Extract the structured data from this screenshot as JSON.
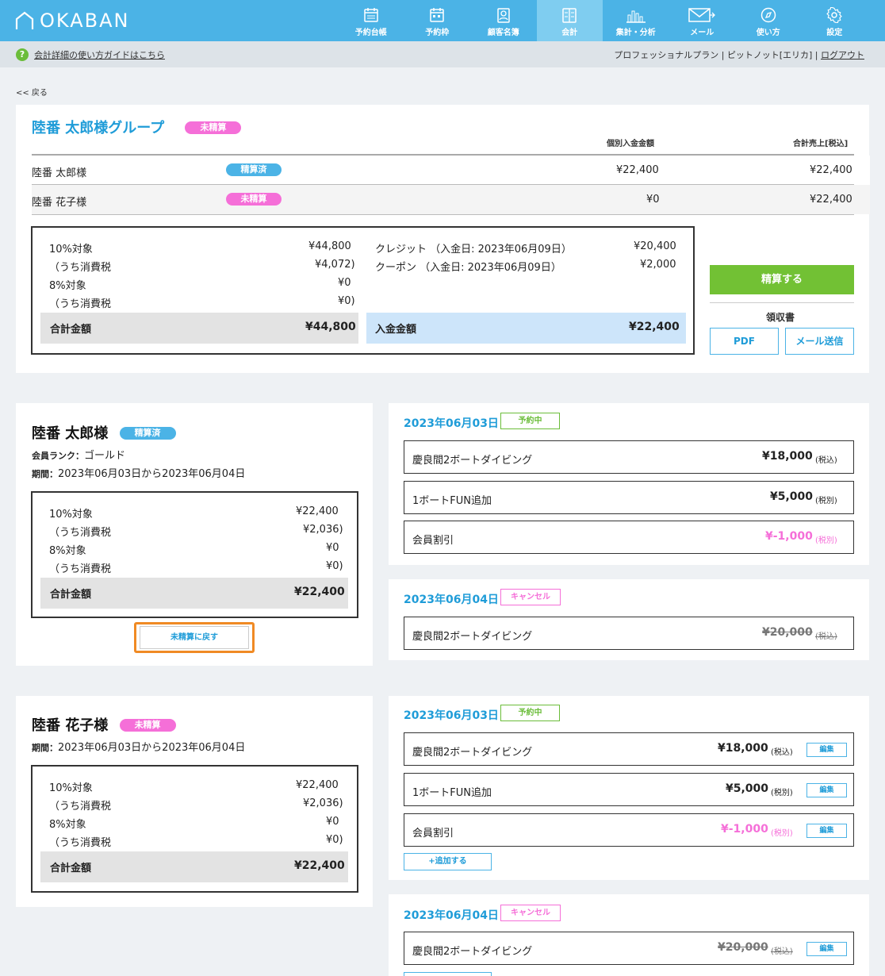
{
  "app": {
    "logo": "OKABAN"
  },
  "nav": [
    {
      "label": "予約台帳",
      "icon": "calendar-list-icon"
    },
    {
      "label": "予約枠",
      "icon": "calendar-slot-icon"
    },
    {
      "label": "顧客名簿",
      "icon": "contacts-book-icon"
    },
    {
      "label": "会計",
      "icon": "ledger-icon"
    },
    {
      "label": "集計・分析",
      "icon": "bar-chart-icon"
    },
    {
      "label": "メール",
      "icon": "mail-icon"
    },
    {
      "label": "使い方",
      "icon": "compass-icon"
    },
    {
      "label": "設定",
      "icon": "gear-icon"
    }
  ],
  "subbar": {
    "help_text": "会計詳細の使い方ガイドはこちら",
    "account": "プロフェッショナルプラン | ピットノット[エリカ] |",
    "logout": "ログアウト"
  },
  "back": "<< 戻る",
  "group": {
    "title": "陸番 太郎様グループ",
    "status": "未精算",
    "col_individual": "個別入金金額",
    "col_total": "合計売上[税込]",
    "members": [
      {
        "name": "陸番 太郎様",
        "status": "精算済",
        "paid": "¥22,400",
        "total": "¥22,400"
      },
      {
        "name": "陸番 花子様",
        "status": "未精算",
        "paid": "¥0",
        "total": "¥22,400"
      }
    ],
    "summary": {
      "r10_label": "10%対象",
      "r10": "¥44,800",
      "t10_label": "（うち消費税",
      "t10": "¥4,072)",
      "r8_label": "8%対象",
      "r8": "¥0",
      "t8_label": "（うち消費税",
      "t8": "¥0)",
      "total_label": "合計金額",
      "total": "¥44,800"
    },
    "payments": [
      {
        "label": "クレジット （入金日: 2023年06月09日）",
        "amount": "¥20,400"
      },
      {
        "label": "クーポン （入金日: 2023年06月09日）",
        "amount": "¥2,000"
      }
    ],
    "paid_label": "入金金額",
    "paid_total": "¥22,400",
    "settle_button": "精算する",
    "receipt_label": "領収書",
    "pdf_button": "PDF",
    "mail_button": "メール送信"
  },
  "persons": [
    {
      "name": "陸番 太郎様",
      "status": "精算済",
      "rank_label": "会員ランク：",
      "rank": "ゴールド",
      "period_label": "期間：",
      "period": "2023年06月03日から2023年06月04日",
      "summary": {
        "r10_label": "10%対象",
        "r10": "¥22,400",
        "t10_label": "（うち消費税",
        "t10": "¥2,036)",
        "r8_label": "8%対象",
        "r8": "¥0",
        "t8_label": "（うち消費税",
        "t8": "¥0)",
        "total_label": "合計金額",
        "total": "¥22,400"
      },
      "revert_button": "未精算に戻す",
      "days": [
        {
          "date": "2023年06月03日",
          "tag": "予約中",
          "items": [
            {
              "name": "慶良間2ボートダイビング",
              "price": "¥18,000",
              "tax": "(税込)"
            },
            {
              "name": "1ボートFUN追加",
              "price": "¥5,000",
              "tax": "(税別)"
            },
            {
              "name": "会員割引",
              "price": "¥-1,000",
              "tax": "(税別)"
            }
          ]
        },
        {
          "date": "2023年06月04日",
          "tag": "キャンセル",
          "items": [
            {
              "name": "慶良間2ボートダイビング",
              "price": "¥20,000",
              "tax": "(税込)"
            }
          ]
        }
      ]
    },
    {
      "name": "陸番 花子様",
      "status": "未精算",
      "period_label": "期間：",
      "period": "2023年06月03日から2023年06月04日",
      "summary": {
        "r10_label": "10%対象",
        "r10": "¥22,400",
        "t10_label": "（うち消費税",
        "t10": "¥2,036)",
        "r8_label": "8%対象",
        "r8": "¥0",
        "t8_label": "（うち消費税",
        "t8": "¥0)",
        "total_label": "合計金額",
        "total": "¥22,400"
      },
      "edit_label": "編集",
      "add_button": "+追加する",
      "days": [
        {
          "date": "2023年06月03日",
          "tag": "予約中",
          "items": [
            {
              "name": "慶良間2ボートダイビング",
              "price": "¥18,000",
              "tax": "(税込)"
            },
            {
              "name": "1ボートFUN追加",
              "price": "¥5,000",
              "tax": "(税別)"
            },
            {
              "name": "会員割引",
              "price": "¥-1,000",
              "tax": "(税別)"
            }
          ]
        },
        {
          "date": "2023年06月04日",
          "tag": "キャンセル",
          "items": [
            {
              "name": "慶良間2ボートダイビング",
              "price": "¥20,000",
              "tax": "(税込)"
            }
          ]
        }
      ]
    }
  ],
  "colors": {
    "header": "#4bb3e6",
    "accent": "#1f9cd8",
    "unpaid": "#f56fd8",
    "settle": "#72c134",
    "highlight": "#f08a24"
  }
}
